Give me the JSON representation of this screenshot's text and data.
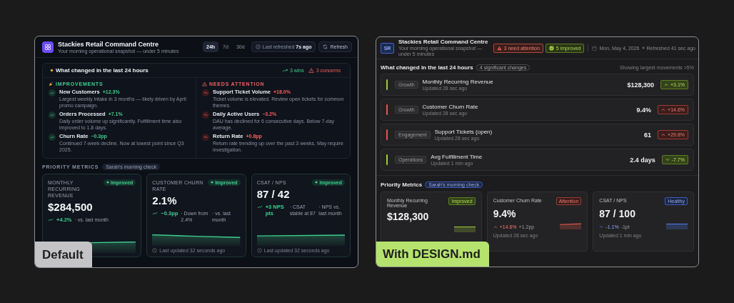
{
  "default_window": {
    "caption": "Default",
    "header": {
      "title": "Stackies Retail Command Centre",
      "subtitle": "Your morning operational snapshot — under 5 minutes",
      "ranges": [
        {
          "label": "24h",
          "selected": true
        },
        {
          "label": "7d",
          "selected": false
        },
        {
          "label": "30d",
          "selected": false
        }
      ],
      "refreshed": "Last refreshed **7s ago**",
      "refresh_button": "Refresh"
    },
    "changes": {
      "title": "What changed in the last 24 hours",
      "wins": "3 wins",
      "concerns": "3 concerns",
      "improvements": {
        "heading": "IMPROVEMENTS",
        "items": [
          {
            "name": "New Customers",
            "delta": "+12.3%",
            "note": "Largest weekly intake in 3 months — likely driven by April promo campaign."
          },
          {
            "name": "Orders Processed",
            "delta": "+7.1%",
            "note": "Daily order volume up significantly. Fulfillment time also improved to 1.8 days."
          },
          {
            "name": "Churn Rate",
            "delta": "−0.3pp",
            "note": "Continued 7-week decline. Now at lowest point since Q3 2025."
          }
        ]
      },
      "attention": {
        "heading": "NEEDS ATTENTION",
        "items": [
          {
            "name": "Support Ticket Volume",
            "delta": "+18.0%",
            "note": "Ticket volume is elevated. Review open tickets for common themes."
          },
          {
            "name": "Daily Active Users",
            "delta": "−3.2%",
            "note": "DAU has declined for 6 consecutive days. Below 7-day average."
          },
          {
            "name": "Return Rate",
            "delta": "+0.8pp",
            "note": "Return rate trending up over the past 3 weeks. May require investigation."
          }
        ]
      }
    },
    "metrics": {
      "label": "PRIORITY METRICS",
      "tag": "Sarah's morning check",
      "cards": [
        {
          "title": "MONTHLY RECURRING REVENUE",
          "badge": "Improved",
          "value": "$284,500",
          "delta": "+4.2%",
          "notes": [
            "· vs. last month"
          ],
          "kind": "rising"
        },
        {
          "title": "CUSTOMER CHURN RATE",
          "badge": "Improved",
          "value": "2.1%",
          "delta": "−0.3pp",
          "notes": [
            "· Down from 2.4%",
            "· vs. last month"
          ],
          "kind": "falling",
          "footer": "Last updated 32 seconds ago"
        },
        {
          "title": "CSAT / NPS",
          "badge": "Improved",
          "value": "87 / 42",
          "delta": "+3 NPS pts",
          "notes": [
            "· CSAT stable at 87",
            "· NPS vs. last month"
          ],
          "kind": "steady",
          "footer": "Last updated 32 seconds ago"
        }
      ]
    }
  },
  "design_window": {
    "caption": "With DESIGN.md",
    "header": {
      "avatar": "SR",
      "title": "Stackies Retail Command Centre",
      "subtitle": "Your morning operational snapshot — under 5 minutes",
      "alerts": [
        {
          "kind": "warning",
          "text": "3 need attention"
        },
        {
          "kind": "success",
          "text": "5 improved"
        }
      ],
      "date": "Mon, May 4, 2026",
      "refreshed": "Refreshed 41 sec ago"
    },
    "changes": {
      "title": "What changed in the last 24 hours",
      "count": "4 significant changes",
      "note": "Showing largest movements >5%",
      "rows": [
        {
          "tag": "Growth",
          "name": "Monthly Recurring Revenue",
          "updated": "Updated 28 sec ago",
          "value": "$128,300",
          "change": "+3.1%",
          "rising": true,
          "kind": "good"
        },
        {
          "tag": "Growth",
          "name": "Customer Churn Rate",
          "updated": "Updated 28 sec ago",
          "value": "9.4%",
          "change": "+14.6%",
          "rising": true,
          "kind": "bad"
        },
        {
          "tag": "Engagement",
          "name": "Support Tickets (open)",
          "updated": "Updated 28 sec ago",
          "value": "61",
          "change": "+29.8%",
          "rising": true,
          "kind": "bad"
        },
        {
          "tag": "Operations",
          "name": "Avg Fulfillment Time",
          "updated": "Updated 1 min ago",
          "value": "2.4 days",
          "change": "-7.7%",
          "rising": false,
          "kind": "good"
        }
      ]
    },
    "metrics": {
      "label": "Priority Metrics",
      "tag": "Sarah's morning check",
      "cards": [
        {
          "title": "Monthly Recurring Revenue",
          "badge": "Improved",
          "kind": "good",
          "value": "$128,300"
        },
        {
          "title": "Customer Churn Rate",
          "badge": "Attention",
          "kind": "bad",
          "value": "9.4%",
          "change": "+14.6%",
          "rising": true,
          "secondary": "+1.2pp",
          "footer": "Updated 28 sec ago"
        },
        {
          "title": "CSAT / NPS",
          "badge": "Healthy",
          "kind": "info",
          "value": "87 / 100",
          "change": "-1.1%",
          "rising": false,
          "secondary": "-1pt",
          "footer": "Updated 1 min ago"
        }
      ]
    }
  }
}
